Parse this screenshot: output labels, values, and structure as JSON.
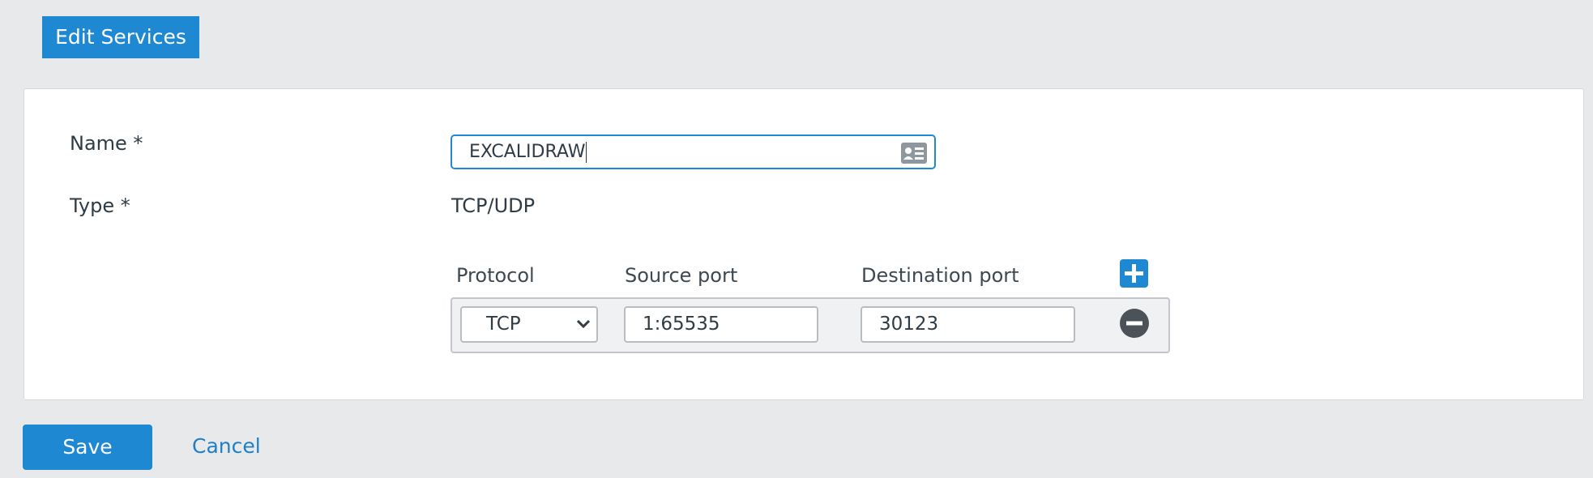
{
  "header": {
    "title": "Edit Services"
  },
  "form": {
    "name_label": "Name *",
    "name_value": "EXCALIDRAW",
    "type_label": "Type *",
    "type_value": "TCP/UDP"
  },
  "services_table": {
    "columns": [
      "Protocol",
      "Source port",
      "Destination port"
    ],
    "rows": [
      {
        "protocol": "TCP",
        "source_port": "1:65535",
        "destination_port": "30123"
      }
    ]
  },
  "actions": {
    "save_label": "Save",
    "cancel_label": "Cancel"
  },
  "icons": {
    "name_field": "contact-card-icon",
    "add": "plus-icon",
    "remove": "minus-circle-icon",
    "select": "chevron-down-icon"
  },
  "colors": {
    "accent": "#1e88d2",
    "background": "#e8e9eb"
  }
}
